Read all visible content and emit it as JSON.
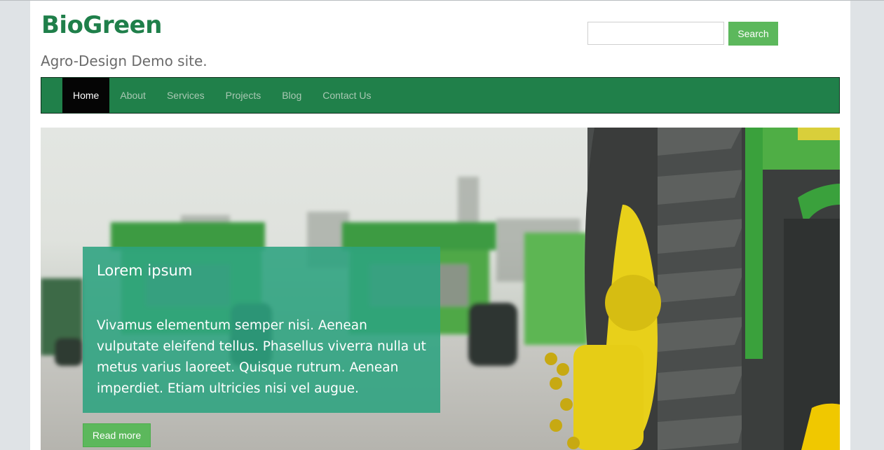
{
  "site": {
    "title": "BioGreen",
    "tagline": "Agro-Design Demo site."
  },
  "search": {
    "placeholder": "",
    "button_label": "Search"
  },
  "nav": {
    "items": [
      {
        "label": "Home",
        "active": true
      },
      {
        "label": "About"
      },
      {
        "label": "Services"
      },
      {
        "label": "Projects"
      },
      {
        "label": "Blog"
      },
      {
        "label": "Contact Us"
      }
    ]
  },
  "hero": {
    "caption_title": "Lorem ipsum",
    "caption_text": "Vivamus elementum semper nisi. Aenean vulputate eleifend tellus. Phasellus viverra nulla ut metus varius laoreet. Quisque rutrum. Aenean imperdiet. Etiam ultricies nisi vel augue.",
    "read_more_label": "Read more"
  },
  "colors": {
    "brand_green": "#1f7f4a",
    "nav_green": "#20804a",
    "button_green": "#5cb85c",
    "caption_teal": "#2ca380"
  }
}
